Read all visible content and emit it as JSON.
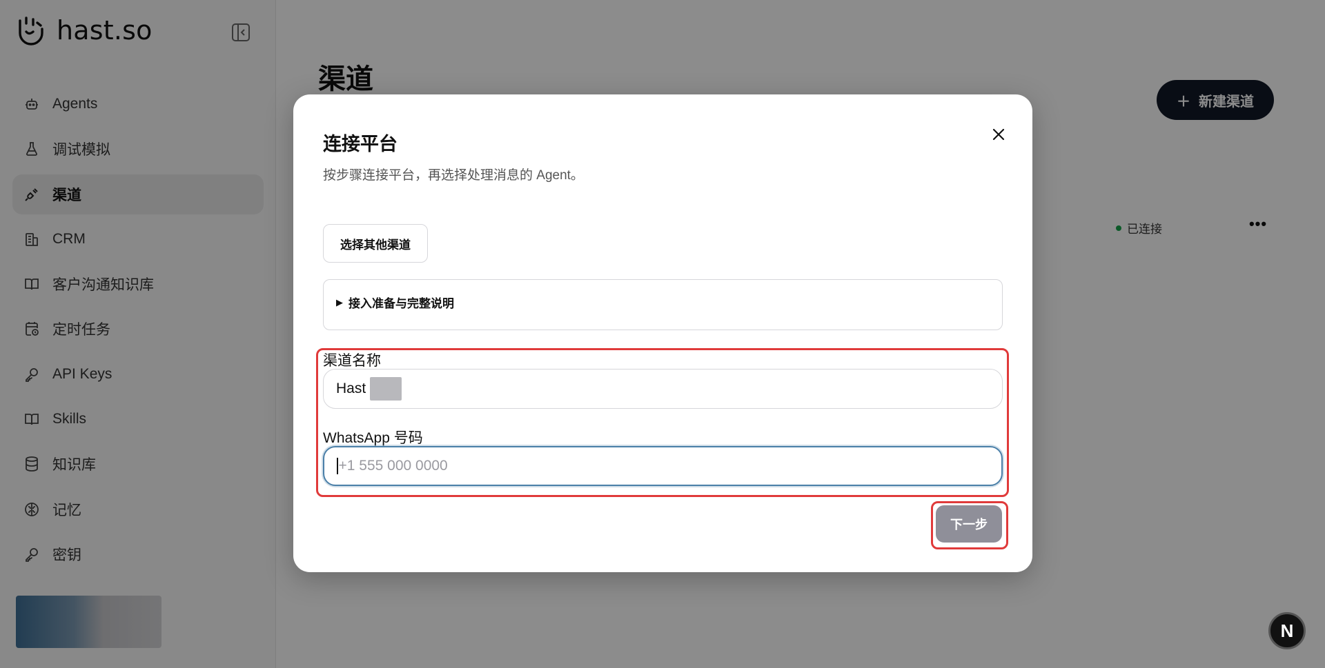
{
  "app": {
    "brand_name": "hast.so"
  },
  "sidebar": {
    "items": [
      {
        "label": "Agents",
        "icon": "robot-icon"
      },
      {
        "label": "调试模拟",
        "icon": "flask-icon"
      },
      {
        "label": "渠道",
        "icon": "plug-icon",
        "active": true
      },
      {
        "label": "CRM",
        "icon": "building-icon"
      },
      {
        "label": "客户沟通知识库",
        "icon": "book-open-icon"
      },
      {
        "label": "定时任务",
        "icon": "calendar-clock-icon"
      },
      {
        "label": "API Keys",
        "icon": "key-icon"
      },
      {
        "label": "Skills",
        "icon": "book-open-icon"
      },
      {
        "label": "知识库",
        "icon": "database-icon"
      },
      {
        "label": "记忆",
        "icon": "brain-icon"
      },
      {
        "label": "密钥",
        "icon": "key-icon"
      }
    ]
  },
  "main": {
    "page_title": "渠道",
    "new_channel_button": "新建渠道",
    "status_text": "已连接",
    "status_color": "#16a34a",
    "fab_label": "N"
  },
  "dialog": {
    "title": "连接平台",
    "subtitle": "按步骤连接平台，再选择处理消息的 Agent。",
    "other_channel_button": "选择其他渠道",
    "details_summary": "接入准备与完整说明",
    "channel_name_label": "渠道名称",
    "channel_name_value": "Hast",
    "whatsapp_label": "WhatsApp 号码",
    "whatsapp_placeholder": "+1 555 000 0000",
    "next_button": "下一步"
  },
  "colors": {
    "primary_dark": "#111827",
    "highlight_red": "#e03a3a",
    "focus_blue": "#4a7fa8",
    "disabled_button": "#8f8f99"
  }
}
